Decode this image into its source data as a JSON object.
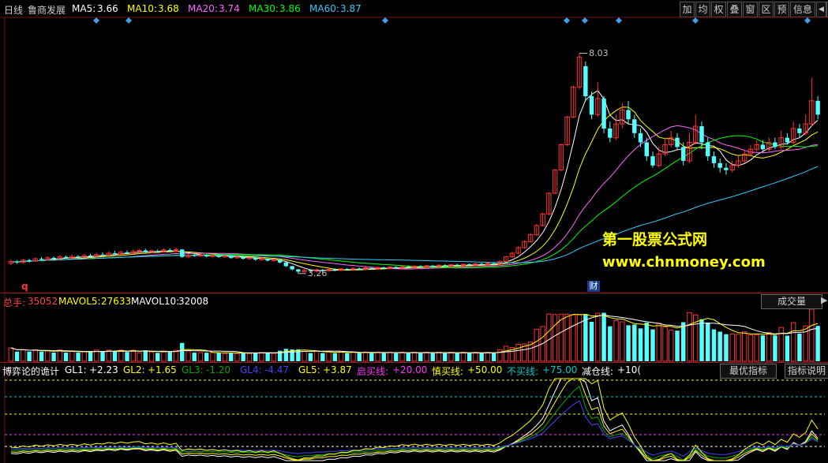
{
  "header": {
    "period": "日线",
    "stock_name": "鲁商发展",
    "ma": [
      {
        "label": "MA5:",
        "value": "3.66",
        "color": "#ffffff"
      },
      {
        "label": "MA10:",
        "value": "3.68",
        "color": "#ffff00"
      },
      {
        "label": "MA20:",
        "value": "3.74",
        "color": "#ff66ff"
      },
      {
        "label": "MA30:",
        "value": "3.86",
        "color": "#00ff00"
      },
      {
        "label": "MA60:",
        "value": "3.87",
        "color": "#33ccff"
      }
    ]
  },
  "toolbar": {
    "buttons": [
      "加",
      "均",
      "权",
      "叠",
      "窗",
      "区",
      "预",
      "信息"
    ],
    "nav_left": "◀",
    "nav_right": "▶"
  },
  "price_labels": {
    "high": "8.03",
    "low": "3.26"
  },
  "markers": {
    "q": "q",
    "cai": "财"
  },
  "watermark": {
    "line1": "第一股票公式网",
    "line2": "www.chnmoney.com"
  },
  "volume": {
    "label": "总手:",
    "value": "35052",
    "mavol5_label": "MAVOL5:",
    "mavol5": "27633",
    "mavol10_label": "MAVOL10:",
    "mavol10": "32008",
    "button": "成交量",
    "arrow": "▶"
  },
  "indicator": {
    "name": "博弈论的诡计",
    "items": [
      {
        "label": "GL1:",
        "value": "+2.23",
        "color": "#ffffff"
      },
      {
        "label": "GL2:",
        "value": "+1.65",
        "color": "#ffff00"
      },
      {
        "label": "GL3:",
        "value": "-1.20",
        "color": "#00aa00"
      },
      {
        "label": "GL4:",
        "value": "-4.47",
        "color": "#4444ff"
      },
      {
        "label": "GL5:",
        "value": "+3.87",
        "color": "#ffff00"
      },
      {
        "label": "启买线:",
        "value": "+20.00",
        "color": "#ff33ff"
      },
      {
        "label": "慎买线:",
        "value": "+50.00",
        "color": "#ffff00"
      },
      {
        "label": "不买线:",
        "value": "+75.00",
        "color": "#00cccc"
      },
      {
        "label": "减仓线:",
        "value": "+10(",
        "color": "#ffffff"
      }
    ],
    "button_best": "最优指标",
    "button_explain": "指标说明"
  },
  "chart_data": {
    "type": "candlestick",
    "stock": "鲁商发展",
    "period": "日线",
    "price_range": [
      3.0,
      8.5
    ],
    "annotated_high": 8.03,
    "annotated_low": 3.26,
    "candles": [
      {
        "o": 3.48,
        "c": 3.52,
        "h": 3.56,
        "l": 3.44
      },
      {
        "o": 3.52,
        "c": 3.5,
        "h": 3.55,
        "l": 3.47
      },
      {
        "o": 3.5,
        "c": 3.55,
        "h": 3.58,
        "l": 3.48
      },
      {
        "o": 3.55,
        "c": 3.53,
        "h": 3.58,
        "l": 3.5
      },
      {
        "o": 3.53,
        "c": 3.58,
        "h": 3.61,
        "l": 3.51
      },
      {
        "o": 3.58,
        "c": 3.56,
        "h": 3.62,
        "l": 3.54
      },
      {
        "o": 3.56,
        "c": 3.6,
        "h": 3.63,
        "l": 3.54
      },
      {
        "o": 3.6,
        "c": 3.58,
        "h": 3.63,
        "l": 3.56
      },
      {
        "o": 3.58,
        "c": 3.62,
        "h": 3.66,
        "l": 3.56
      },
      {
        "o": 3.62,
        "c": 3.6,
        "h": 3.65,
        "l": 3.58
      },
      {
        "o": 3.6,
        "c": 3.63,
        "h": 3.67,
        "l": 3.58
      },
      {
        "o": 3.63,
        "c": 3.61,
        "h": 3.66,
        "l": 3.59
      },
      {
        "o": 3.61,
        "c": 3.65,
        "h": 3.68,
        "l": 3.6
      },
      {
        "o": 3.65,
        "c": 3.63,
        "h": 3.69,
        "l": 3.61
      },
      {
        "o": 3.63,
        "c": 3.67,
        "h": 3.71,
        "l": 3.61
      },
      {
        "o": 3.67,
        "c": 3.66,
        "h": 3.72,
        "l": 3.64
      },
      {
        "o": 3.66,
        "c": 3.7,
        "h": 3.74,
        "l": 3.64
      },
      {
        "o": 3.7,
        "c": 3.68,
        "h": 3.75,
        "l": 3.66
      },
      {
        "o": 3.68,
        "c": 3.72,
        "h": 3.76,
        "l": 3.66
      },
      {
        "o": 3.72,
        "c": 3.7,
        "h": 3.76,
        "l": 3.68
      },
      {
        "o": 3.7,
        "c": 3.74,
        "h": 3.78,
        "l": 3.68
      },
      {
        "o": 3.74,
        "c": 3.76,
        "h": 3.79,
        "l": 3.72
      },
      {
        "o": 3.76,
        "c": 3.72,
        "h": 3.8,
        "l": 3.7
      },
      {
        "o": 3.72,
        "c": 3.75,
        "h": 3.78,
        "l": 3.7
      },
      {
        "o": 3.75,
        "c": 3.73,
        "h": 3.78,
        "l": 3.71
      },
      {
        "o": 3.73,
        "c": 3.77,
        "h": 3.8,
        "l": 3.71
      },
      {
        "o": 3.77,
        "c": 3.74,
        "h": 3.8,
        "l": 3.72
      },
      {
        "o": 3.74,
        "c": 3.78,
        "h": 3.82,
        "l": 3.72
      },
      {
        "o": 3.78,
        "c": 3.62,
        "h": 3.79,
        "l": 3.6
      },
      {
        "o": 3.62,
        "c": 3.66,
        "h": 3.69,
        "l": 3.6
      },
      {
        "o": 3.66,
        "c": 3.64,
        "h": 3.69,
        "l": 3.62
      },
      {
        "o": 3.64,
        "c": 3.66,
        "h": 3.69,
        "l": 3.62
      },
      {
        "o": 3.66,
        "c": 3.63,
        "h": 3.68,
        "l": 3.61
      },
      {
        "o": 3.63,
        "c": 3.65,
        "h": 3.68,
        "l": 3.61
      },
      {
        "o": 3.65,
        "c": 3.62,
        "h": 3.67,
        "l": 3.6
      },
      {
        "o": 3.62,
        "c": 3.64,
        "h": 3.66,
        "l": 3.6
      },
      {
        "o": 3.64,
        "c": 3.6,
        "h": 3.65,
        "l": 3.58
      },
      {
        "o": 3.6,
        "c": 3.62,
        "h": 3.64,
        "l": 3.58
      },
      {
        "o": 3.62,
        "c": 3.58,
        "h": 3.63,
        "l": 3.56
      },
      {
        "o": 3.58,
        "c": 3.6,
        "h": 3.62,
        "l": 3.56
      },
      {
        "o": 3.6,
        "c": 3.56,
        "h": 3.61,
        "l": 3.54
      },
      {
        "o": 3.56,
        "c": 3.58,
        "h": 3.61,
        "l": 3.54
      },
      {
        "o": 3.58,
        "c": 3.54,
        "h": 3.59,
        "l": 3.52
      },
      {
        "o": 3.54,
        "c": 3.56,
        "h": 3.58,
        "l": 3.52
      },
      {
        "o": 3.56,
        "c": 3.5,
        "h": 3.57,
        "l": 3.48
      },
      {
        "o": 3.5,
        "c": 3.42,
        "h": 3.51,
        "l": 3.4
      },
      {
        "o": 3.42,
        "c": 3.35,
        "h": 3.43,
        "l": 3.33
      },
      {
        "o": 3.35,
        "c": 3.3,
        "h": 3.36,
        "l": 3.26
      },
      {
        "o": 3.3,
        "c": 3.33,
        "h": 3.36,
        "l": 3.28
      },
      {
        "o": 3.33,
        "c": 3.31,
        "h": 3.35,
        "l": 3.29
      },
      {
        "o": 3.31,
        "c": 3.34,
        "h": 3.37,
        "l": 3.29
      },
      {
        "o": 3.34,
        "c": 3.32,
        "h": 3.36,
        "l": 3.3
      },
      {
        "o": 3.32,
        "c": 3.35,
        "h": 3.38,
        "l": 3.3
      },
      {
        "o": 3.35,
        "c": 3.33,
        "h": 3.37,
        "l": 3.31
      },
      {
        "o": 3.33,
        "c": 3.36,
        "h": 3.38,
        "l": 3.31
      },
      {
        "o": 3.36,
        "c": 3.34,
        "h": 3.38,
        "l": 3.32
      },
      {
        "o": 3.34,
        "c": 3.37,
        "h": 3.39,
        "l": 3.32
      },
      {
        "o": 3.37,
        "c": 3.35,
        "h": 3.39,
        "l": 3.33
      },
      {
        "o": 3.35,
        "c": 3.38,
        "h": 3.4,
        "l": 3.33
      },
      {
        "o": 3.38,
        "c": 3.36,
        "h": 3.4,
        "l": 3.34
      },
      {
        "o": 3.36,
        "c": 3.39,
        "h": 3.41,
        "l": 3.34
      },
      {
        "o": 3.39,
        "c": 3.37,
        "h": 3.41,
        "l": 3.35
      },
      {
        "o": 3.37,
        "c": 3.4,
        "h": 3.42,
        "l": 3.35
      },
      {
        "o": 3.4,
        "c": 3.38,
        "h": 3.42,
        "l": 3.36
      },
      {
        "o": 3.38,
        "c": 3.41,
        "h": 3.43,
        "l": 3.36
      },
      {
        "o": 3.41,
        "c": 3.39,
        "h": 3.43,
        "l": 3.37
      },
      {
        "o": 3.39,
        "c": 3.42,
        "h": 3.44,
        "l": 3.37
      },
      {
        "o": 3.42,
        "c": 3.4,
        "h": 3.44,
        "l": 3.38
      },
      {
        "o": 3.4,
        "c": 3.43,
        "h": 3.45,
        "l": 3.38
      },
      {
        "o": 3.43,
        "c": 3.41,
        "h": 3.45,
        "l": 3.39
      },
      {
        "o": 3.41,
        "c": 3.44,
        "h": 3.46,
        "l": 3.39
      },
      {
        "o": 3.44,
        "c": 3.42,
        "h": 3.46,
        "l": 3.4
      },
      {
        "o": 3.42,
        "c": 3.45,
        "h": 3.47,
        "l": 3.4
      },
      {
        "o": 3.45,
        "c": 3.43,
        "h": 3.47,
        "l": 3.41
      },
      {
        "o": 3.43,
        "c": 3.46,
        "h": 3.48,
        "l": 3.41
      },
      {
        "o": 3.46,
        "c": 3.44,
        "h": 3.48,
        "l": 3.42
      },
      {
        "o": 3.44,
        "c": 3.47,
        "h": 3.49,
        "l": 3.42
      },
      {
        "o": 3.47,
        "c": 3.45,
        "h": 3.49,
        "l": 3.43
      },
      {
        "o": 3.45,
        "c": 3.48,
        "h": 3.5,
        "l": 3.43
      },
      {
        "o": 3.48,
        "c": 3.46,
        "h": 3.5,
        "l": 3.44
      },
      {
        "o": 3.46,
        "c": 3.52,
        "h": 3.54,
        "l": 3.44
      },
      {
        "o": 3.52,
        "c": 3.62,
        "h": 3.64,
        "l": 3.5
      },
      {
        "o": 3.62,
        "c": 3.7,
        "h": 3.73,
        "l": 3.6
      },
      {
        "o": 3.7,
        "c": 3.82,
        "h": 3.85,
        "l": 3.68
      },
      {
        "o": 3.82,
        "c": 3.95,
        "h": 3.98,
        "l": 3.8
      },
      {
        "o": 3.95,
        "c": 4.1,
        "h": 4.14,
        "l": 3.93
      },
      {
        "o": 4.1,
        "c": 4.3,
        "h": 4.33,
        "l": 4.08
      },
      {
        "o": 4.3,
        "c": 4.55,
        "h": 4.58,
        "l": 4.28
      },
      {
        "o": 4.55,
        "c": 5.0,
        "h": 5.02,
        "l": 4.52
      },
      {
        "o": 5.0,
        "c": 5.5,
        "h": 5.52,
        "l": 4.98
      },
      {
        "o": 5.5,
        "c": 6.05,
        "h": 6.08,
        "l": 5.48
      },
      {
        "o": 6.05,
        "c": 6.65,
        "h": 6.68,
        "l": 6.02
      },
      {
        "o": 6.65,
        "c": 7.3,
        "h": 7.33,
        "l": 6.62
      },
      {
        "o": 7.3,
        "c": 7.95,
        "h": 8.03,
        "l": 7.25
      },
      {
        "o": 7.75,
        "c": 7.1,
        "h": 7.85,
        "l": 7.0
      },
      {
        "o": 7.1,
        "c": 6.7,
        "h": 7.2,
        "l": 6.6
      },
      {
        "o": 6.7,
        "c": 7.05,
        "h": 7.4,
        "l": 6.65
      },
      {
        "o": 7.05,
        "c": 6.4,
        "h": 7.1,
        "l": 6.3
      },
      {
        "o": 6.4,
        "c": 6.2,
        "h": 6.55,
        "l": 6.1
      },
      {
        "o": 6.2,
        "c": 6.5,
        "h": 6.7,
        "l": 6.15
      },
      {
        "o": 6.5,
        "c": 6.8,
        "h": 6.95,
        "l": 6.4
      },
      {
        "o": 6.8,
        "c": 6.6,
        "h": 7.0,
        "l": 6.5
      },
      {
        "o": 6.6,
        "c": 6.3,
        "h": 6.7,
        "l": 6.2
      },
      {
        "o": 6.3,
        "c": 6.1,
        "h": 6.4,
        "l": 6.0
      },
      {
        "o": 6.1,
        "c": 5.8,
        "h": 6.2,
        "l": 5.7
      },
      {
        "o": 5.8,
        "c": 5.6,
        "h": 5.9,
        "l": 5.55
      },
      {
        "o": 5.6,
        "c": 5.85,
        "h": 6.0,
        "l": 5.55
      },
      {
        "o": 5.85,
        "c": 6.05,
        "h": 6.2,
        "l": 5.8
      },
      {
        "o": 6.05,
        "c": 6.2,
        "h": 6.35,
        "l": 6.0
      },
      {
        "o": 6.2,
        "c": 6.0,
        "h": 6.3,
        "l": 5.95
      },
      {
        "o": 6.0,
        "c": 5.7,
        "h": 6.1,
        "l": 5.6
      },
      {
        "o": 5.7,
        "c": 6.1,
        "h": 6.3,
        "l": 5.65
      },
      {
        "o": 6.1,
        "c": 6.45,
        "h": 6.7,
        "l": 6.05
      },
      {
        "o": 6.45,
        "c": 6.1,
        "h": 6.55,
        "l": 5.95
      },
      {
        "o": 6.1,
        "c": 5.8,
        "h": 6.2,
        "l": 5.7
      },
      {
        "o": 5.8,
        "c": 5.65,
        "h": 5.9,
        "l": 5.55
      },
      {
        "o": 5.65,
        "c": 5.55,
        "h": 5.75,
        "l": 5.45
      },
      {
        "o": 5.55,
        "c": 5.5,
        "h": 5.65,
        "l": 5.4
      },
      {
        "o": 5.5,
        "c": 5.6,
        "h": 5.7,
        "l": 5.45
      },
      {
        "o": 5.6,
        "c": 5.7,
        "h": 5.8,
        "l": 5.55
      },
      {
        "o": 5.7,
        "c": 5.85,
        "h": 5.95,
        "l": 5.65
      },
      {
        "o": 5.85,
        "c": 5.95,
        "h": 6.05,
        "l": 5.8
      },
      {
        "o": 5.95,
        "c": 6.05,
        "h": 6.15,
        "l": 5.9
      },
      {
        "o": 6.05,
        "c": 5.95,
        "h": 6.15,
        "l": 5.9
      },
      {
        "o": 5.95,
        "c": 6.1,
        "h": 6.2,
        "l": 5.9
      },
      {
        "o": 6.1,
        "c": 6.0,
        "h": 6.2,
        "l": 5.95
      },
      {
        "o": 6.0,
        "c": 6.2,
        "h": 6.35,
        "l": 5.95
      },
      {
        "o": 6.2,
        "c": 6.1,
        "h": 6.3,
        "l": 6.05
      },
      {
        "o": 6.1,
        "c": 6.4,
        "h": 6.55,
        "l": 6.05
      },
      {
        "o": 6.4,
        "c": 6.3,
        "h": 6.5,
        "l": 6.2
      },
      {
        "o": 6.3,
        "c": 6.5,
        "h": 6.7,
        "l": 6.25
      },
      {
        "o": 6.5,
        "c": 7.0,
        "h": 7.5,
        "l": 6.45
      },
      {
        "o": 7.0,
        "c": 6.7,
        "h": 7.1,
        "l": 6.6
      }
    ]
  }
}
